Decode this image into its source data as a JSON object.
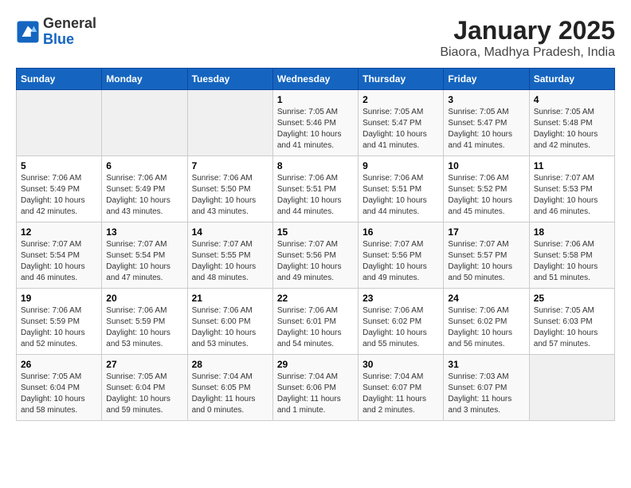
{
  "logo": {
    "general": "General",
    "blue": "Blue"
  },
  "title": "January 2025",
  "subtitle": "Biaora, Madhya Pradesh, India",
  "days_of_week": [
    "Sunday",
    "Monday",
    "Tuesday",
    "Wednesday",
    "Thursday",
    "Friday",
    "Saturday"
  ],
  "weeks": [
    [
      {
        "day": "",
        "info": ""
      },
      {
        "day": "",
        "info": ""
      },
      {
        "day": "",
        "info": ""
      },
      {
        "day": "1",
        "info": "Sunrise: 7:05 AM\nSunset: 5:46 PM\nDaylight: 10 hours and 41 minutes."
      },
      {
        "day": "2",
        "info": "Sunrise: 7:05 AM\nSunset: 5:47 PM\nDaylight: 10 hours and 41 minutes."
      },
      {
        "day": "3",
        "info": "Sunrise: 7:05 AM\nSunset: 5:47 PM\nDaylight: 10 hours and 41 minutes."
      },
      {
        "day": "4",
        "info": "Sunrise: 7:05 AM\nSunset: 5:48 PM\nDaylight: 10 hours and 42 minutes."
      }
    ],
    [
      {
        "day": "5",
        "info": "Sunrise: 7:06 AM\nSunset: 5:49 PM\nDaylight: 10 hours and 42 minutes."
      },
      {
        "day": "6",
        "info": "Sunrise: 7:06 AM\nSunset: 5:49 PM\nDaylight: 10 hours and 43 minutes."
      },
      {
        "day": "7",
        "info": "Sunrise: 7:06 AM\nSunset: 5:50 PM\nDaylight: 10 hours and 43 minutes."
      },
      {
        "day": "8",
        "info": "Sunrise: 7:06 AM\nSunset: 5:51 PM\nDaylight: 10 hours and 44 minutes."
      },
      {
        "day": "9",
        "info": "Sunrise: 7:06 AM\nSunset: 5:51 PM\nDaylight: 10 hours and 44 minutes."
      },
      {
        "day": "10",
        "info": "Sunrise: 7:06 AM\nSunset: 5:52 PM\nDaylight: 10 hours and 45 minutes."
      },
      {
        "day": "11",
        "info": "Sunrise: 7:07 AM\nSunset: 5:53 PM\nDaylight: 10 hours and 46 minutes."
      }
    ],
    [
      {
        "day": "12",
        "info": "Sunrise: 7:07 AM\nSunset: 5:54 PM\nDaylight: 10 hours and 46 minutes."
      },
      {
        "day": "13",
        "info": "Sunrise: 7:07 AM\nSunset: 5:54 PM\nDaylight: 10 hours and 47 minutes."
      },
      {
        "day": "14",
        "info": "Sunrise: 7:07 AM\nSunset: 5:55 PM\nDaylight: 10 hours and 48 minutes."
      },
      {
        "day": "15",
        "info": "Sunrise: 7:07 AM\nSunset: 5:56 PM\nDaylight: 10 hours and 49 minutes."
      },
      {
        "day": "16",
        "info": "Sunrise: 7:07 AM\nSunset: 5:56 PM\nDaylight: 10 hours and 49 minutes."
      },
      {
        "day": "17",
        "info": "Sunrise: 7:07 AM\nSunset: 5:57 PM\nDaylight: 10 hours and 50 minutes."
      },
      {
        "day": "18",
        "info": "Sunrise: 7:06 AM\nSunset: 5:58 PM\nDaylight: 10 hours and 51 minutes."
      }
    ],
    [
      {
        "day": "19",
        "info": "Sunrise: 7:06 AM\nSunset: 5:59 PM\nDaylight: 10 hours and 52 minutes."
      },
      {
        "day": "20",
        "info": "Sunrise: 7:06 AM\nSunset: 5:59 PM\nDaylight: 10 hours and 53 minutes."
      },
      {
        "day": "21",
        "info": "Sunrise: 7:06 AM\nSunset: 6:00 PM\nDaylight: 10 hours and 53 minutes."
      },
      {
        "day": "22",
        "info": "Sunrise: 7:06 AM\nSunset: 6:01 PM\nDaylight: 10 hours and 54 minutes."
      },
      {
        "day": "23",
        "info": "Sunrise: 7:06 AM\nSunset: 6:02 PM\nDaylight: 10 hours and 55 minutes."
      },
      {
        "day": "24",
        "info": "Sunrise: 7:06 AM\nSunset: 6:02 PM\nDaylight: 10 hours and 56 minutes."
      },
      {
        "day": "25",
        "info": "Sunrise: 7:05 AM\nSunset: 6:03 PM\nDaylight: 10 hours and 57 minutes."
      }
    ],
    [
      {
        "day": "26",
        "info": "Sunrise: 7:05 AM\nSunset: 6:04 PM\nDaylight: 10 hours and 58 minutes."
      },
      {
        "day": "27",
        "info": "Sunrise: 7:05 AM\nSunset: 6:04 PM\nDaylight: 10 hours and 59 minutes."
      },
      {
        "day": "28",
        "info": "Sunrise: 7:04 AM\nSunset: 6:05 PM\nDaylight: 11 hours and 0 minutes."
      },
      {
        "day": "29",
        "info": "Sunrise: 7:04 AM\nSunset: 6:06 PM\nDaylight: 11 hours and 1 minute."
      },
      {
        "day": "30",
        "info": "Sunrise: 7:04 AM\nSunset: 6:07 PM\nDaylight: 11 hours and 2 minutes."
      },
      {
        "day": "31",
        "info": "Sunrise: 7:03 AM\nSunset: 6:07 PM\nDaylight: 11 hours and 3 minutes."
      },
      {
        "day": "",
        "info": ""
      }
    ]
  ]
}
